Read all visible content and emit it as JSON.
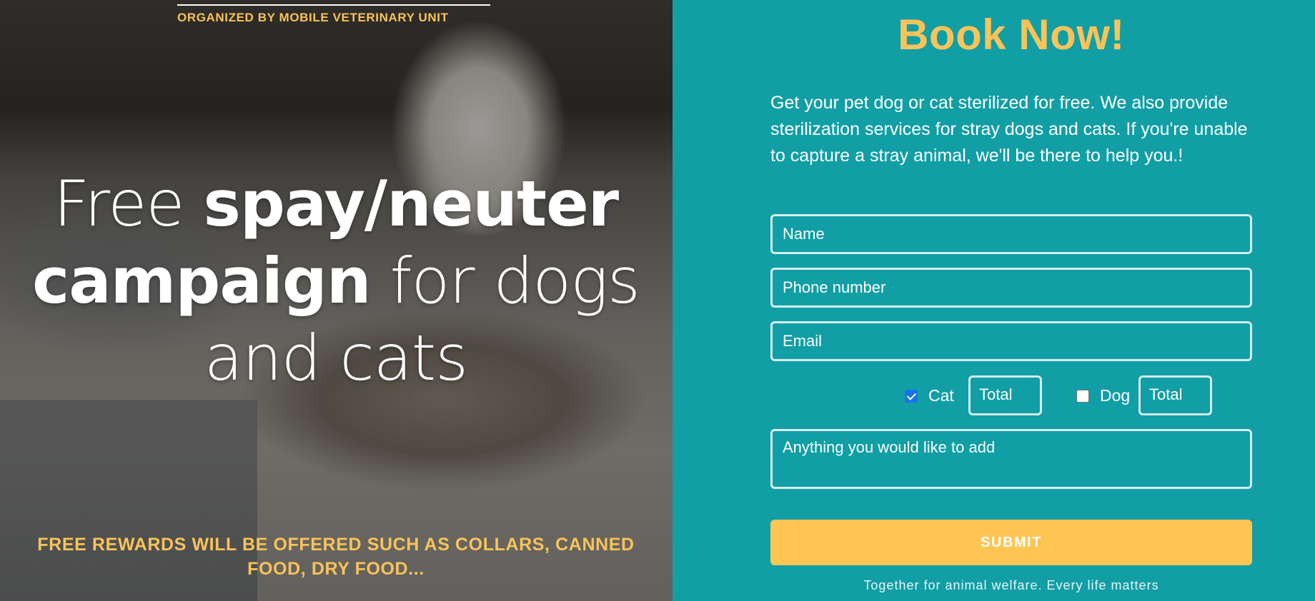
{
  "hero": {
    "organizer": "ORGANIZED BY MOBILE VETERINARY UNIT",
    "headline": {
      "part1": "Free ",
      "part2_bold": "spay/neuter campaign",
      "part3": " for dogs and cats"
    },
    "rewards": "FREE REWARDS WILL BE OFFERED SUCH AS COLLARS, CANNED FOOD, DRY FOOD..."
  },
  "form": {
    "title": "Book Now!",
    "intro": "Get your pet dog or cat sterilized for free. We also provide sterilization services for stray dogs and cats. If you're unable to capture a stray animal, we'll be there to help you.!",
    "name_placeholder": "Name",
    "phone_placeholder": "Phone number",
    "email_placeholder": "Email",
    "cat": {
      "label": "Cat",
      "checked": true,
      "total_placeholder": "Total"
    },
    "dog": {
      "label": "Dog",
      "checked": false,
      "total_placeholder": "Total"
    },
    "notes_placeholder": "Anything you would like to add",
    "submit_label": "SUBMIT",
    "footer": "Together for animal welfare. Every life matters"
  },
  "colors": {
    "panel_bg": "#119ea5",
    "accent_yellow": "#f8c35a",
    "button_yellow": "#fec553",
    "field_border": "#d6ecee"
  }
}
